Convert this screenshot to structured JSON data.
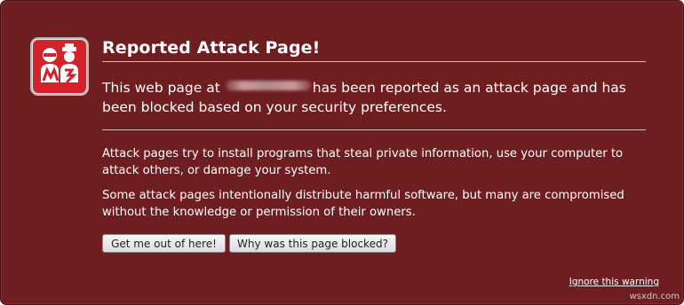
{
  "colors": {
    "background": "#6e1e21",
    "icon_red": "#d2232a",
    "button_bg": "#e8e8e8"
  },
  "warning": {
    "icon": "malware-robber-icon",
    "title": "Reported Attack Page!",
    "headline_before": "This web page at",
    "headline_url_redacted": "",
    "headline_after": "has been reported as an attack page and has been blocked based on your security preferences.",
    "paragraph_1": "Attack pages try to install programs that steal private information, use your computer to attack others, or damage your system.",
    "paragraph_2": "Some attack pages intentionally distribute harmful software, but many are compromised without the knowledge or permission of their owners."
  },
  "buttons": {
    "get_out_label": "Get me out of here!",
    "why_blocked_label": "Why was this page blocked?"
  },
  "footer": {
    "ignore_link": "Ignore this warning",
    "watermark": "wsxdn.com"
  }
}
